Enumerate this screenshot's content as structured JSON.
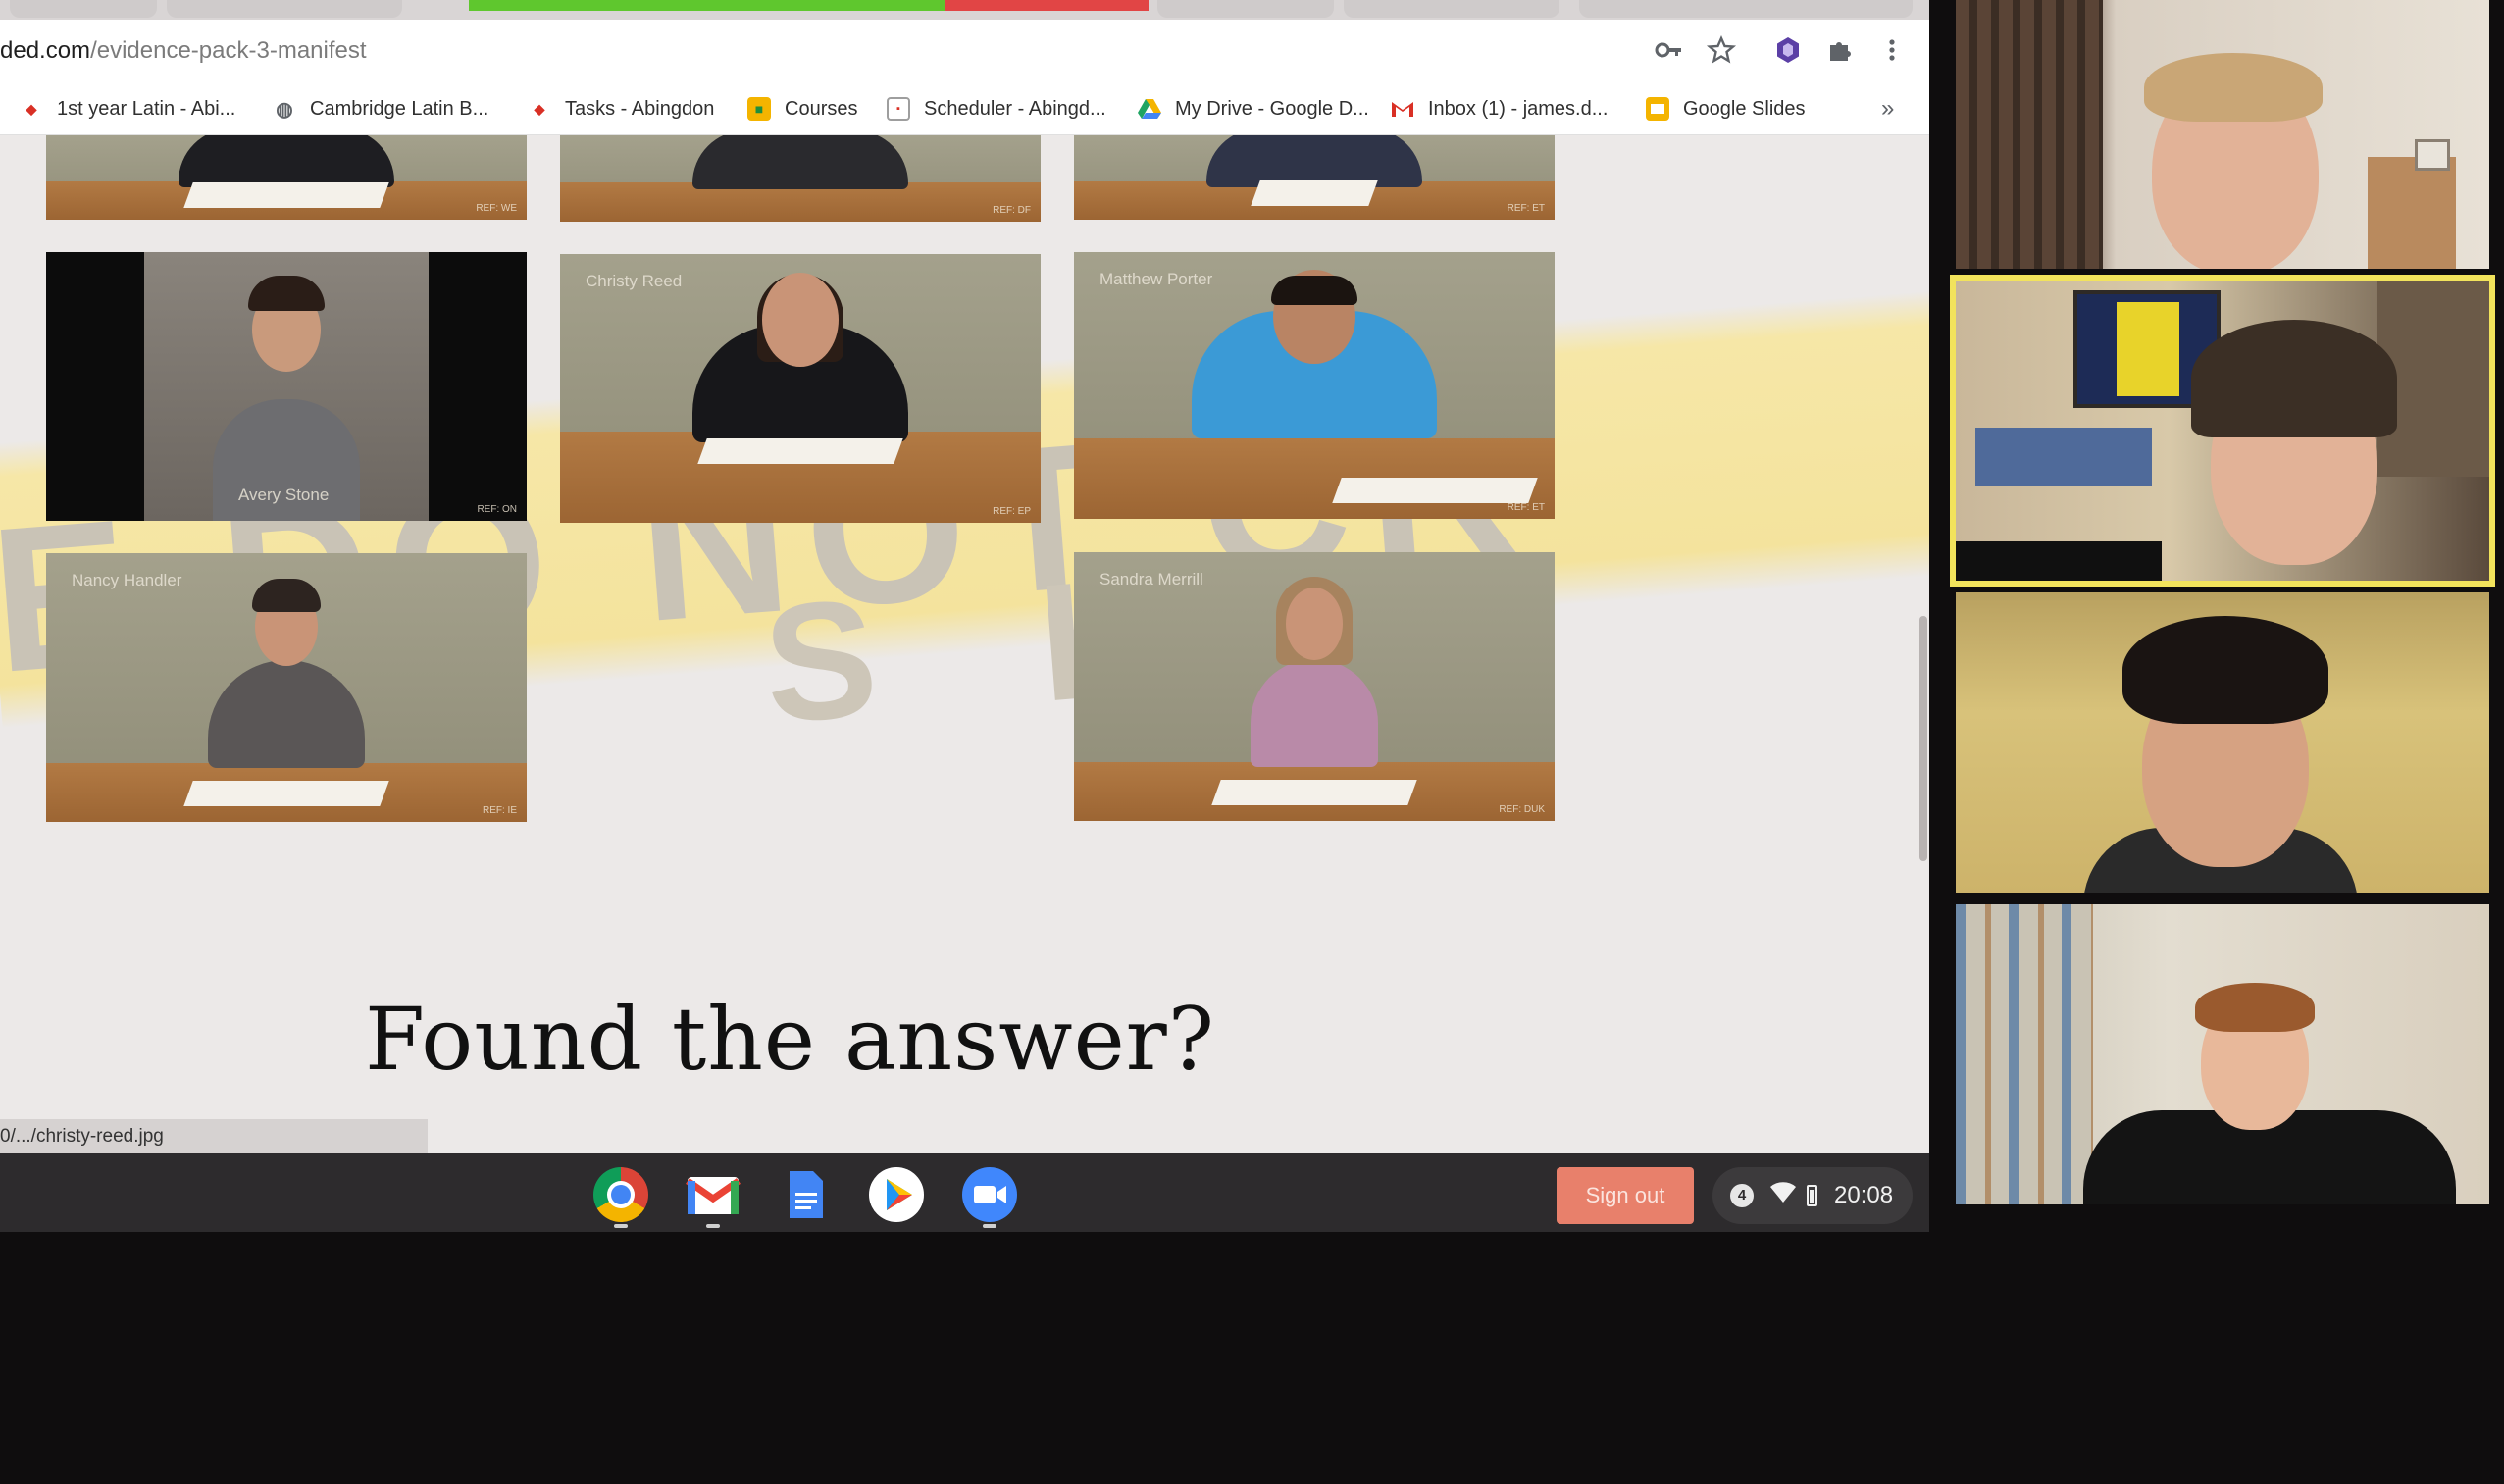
{
  "browser": {
    "url_prefix": "ded.com",
    "url_path": "/evidence-pack-3-manifest",
    "status_link": "0/.../christy-reed.jpg"
  },
  "bookmarks": [
    {
      "label": "1st year Latin - Abi...",
      "icon": "latin-icon",
      "color": "#d93025"
    },
    {
      "label": "Cambridge Latin B...",
      "icon": "globe-icon",
      "color": "#5f6368"
    },
    {
      "label": "Tasks - Abingdon",
      "icon": "tasks-icon",
      "color": "#d93025"
    },
    {
      "label": "Courses",
      "icon": "classroom-icon",
      "color": "#f4b400"
    },
    {
      "label": "Scheduler - Abingd...",
      "icon": "calendar-icon",
      "color": "#9e9e9e"
    },
    {
      "label": "My Drive - Google D...",
      "icon": "drive-icon",
      "color": "#1fa463"
    },
    {
      "label": "Inbox (1) - james.d...",
      "icon": "gmail-icon",
      "color": "#d93025"
    },
    {
      "label": "Google Slides",
      "icon": "slides-icon",
      "color": "#f4b400"
    }
  ],
  "bookmarks_overflow": "»",
  "suspects": [
    {
      "name": "",
      "ref": "REF: WE",
      "shirt": "#1e1e22"
    },
    {
      "name": "",
      "ref": "REF: DF",
      "shirt": "#2a2a2e"
    },
    {
      "name": "",
      "ref": "REF: ET",
      "shirt": "#2f3448"
    },
    {
      "name": "Avery Stone",
      "ref": "REF: ON",
      "shirt": "#6d6d70"
    },
    {
      "name": "Christy Reed",
      "ref": "REF: EP",
      "shirt": "#17171a"
    },
    {
      "name": "Matthew Porter",
      "ref": "REF: ET",
      "shirt": "#3b9ad6"
    },
    {
      "name": "Nancy Handler",
      "ref": "REF: IE",
      "shirt": "#5a5656"
    },
    {
      "name": "Sandra Merrill",
      "ref": "REF: DUK",
      "shirt": "#b98aa8"
    }
  ],
  "tape": {
    "line1": "E DO NOT CR",
    "line2": "S H"
  },
  "page": {
    "headline": "Found the answer?"
  },
  "shelf": {
    "apps": [
      "chrome-icon",
      "gmail-icon",
      "docs-icon",
      "play-store-icon",
      "zoom-icon"
    ],
    "sign_out": "Sign out",
    "notification_count": "4",
    "clock": "20:08"
  },
  "participants": [
    {
      "id": "participant-1",
      "active": false
    },
    {
      "id": "participant-2",
      "active": true
    },
    {
      "id": "participant-3",
      "active": false
    },
    {
      "id": "participant-4",
      "active": false
    }
  ],
  "colors": {
    "active_speaker": "#f2e35c",
    "sign_out": "#e8806b",
    "progress_green": "#5fc72e",
    "progress_red": "#e14545"
  }
}
